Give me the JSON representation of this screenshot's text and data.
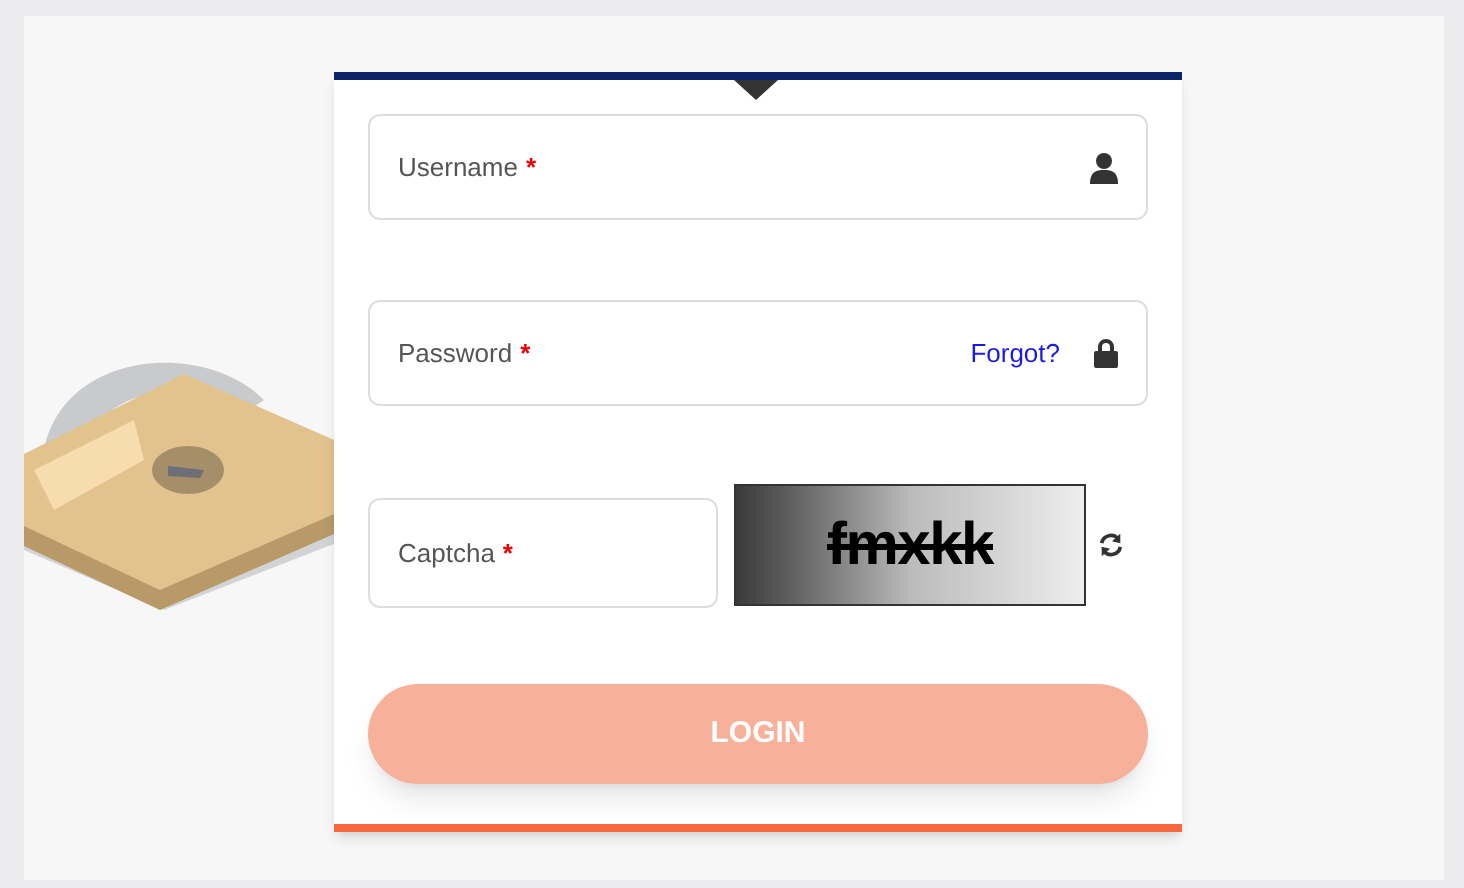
{
  "fields": [
    {
      "kind": "username",
      "label": "Username",
      "required_mark": "*"
    },
    {
      "kind": "password",
      "label": "Password",
      "required_mark": "*",
      "link": "Forgot?"
    },
    {
      "kind": "captcha",
      "label": "Captcha",
      "required_mark": "*",
      "captcha_text": "fmxkk"
    }
  ],
  "login_button": {
    "label": "LOGIN",
    "disabled": true
  }
}
